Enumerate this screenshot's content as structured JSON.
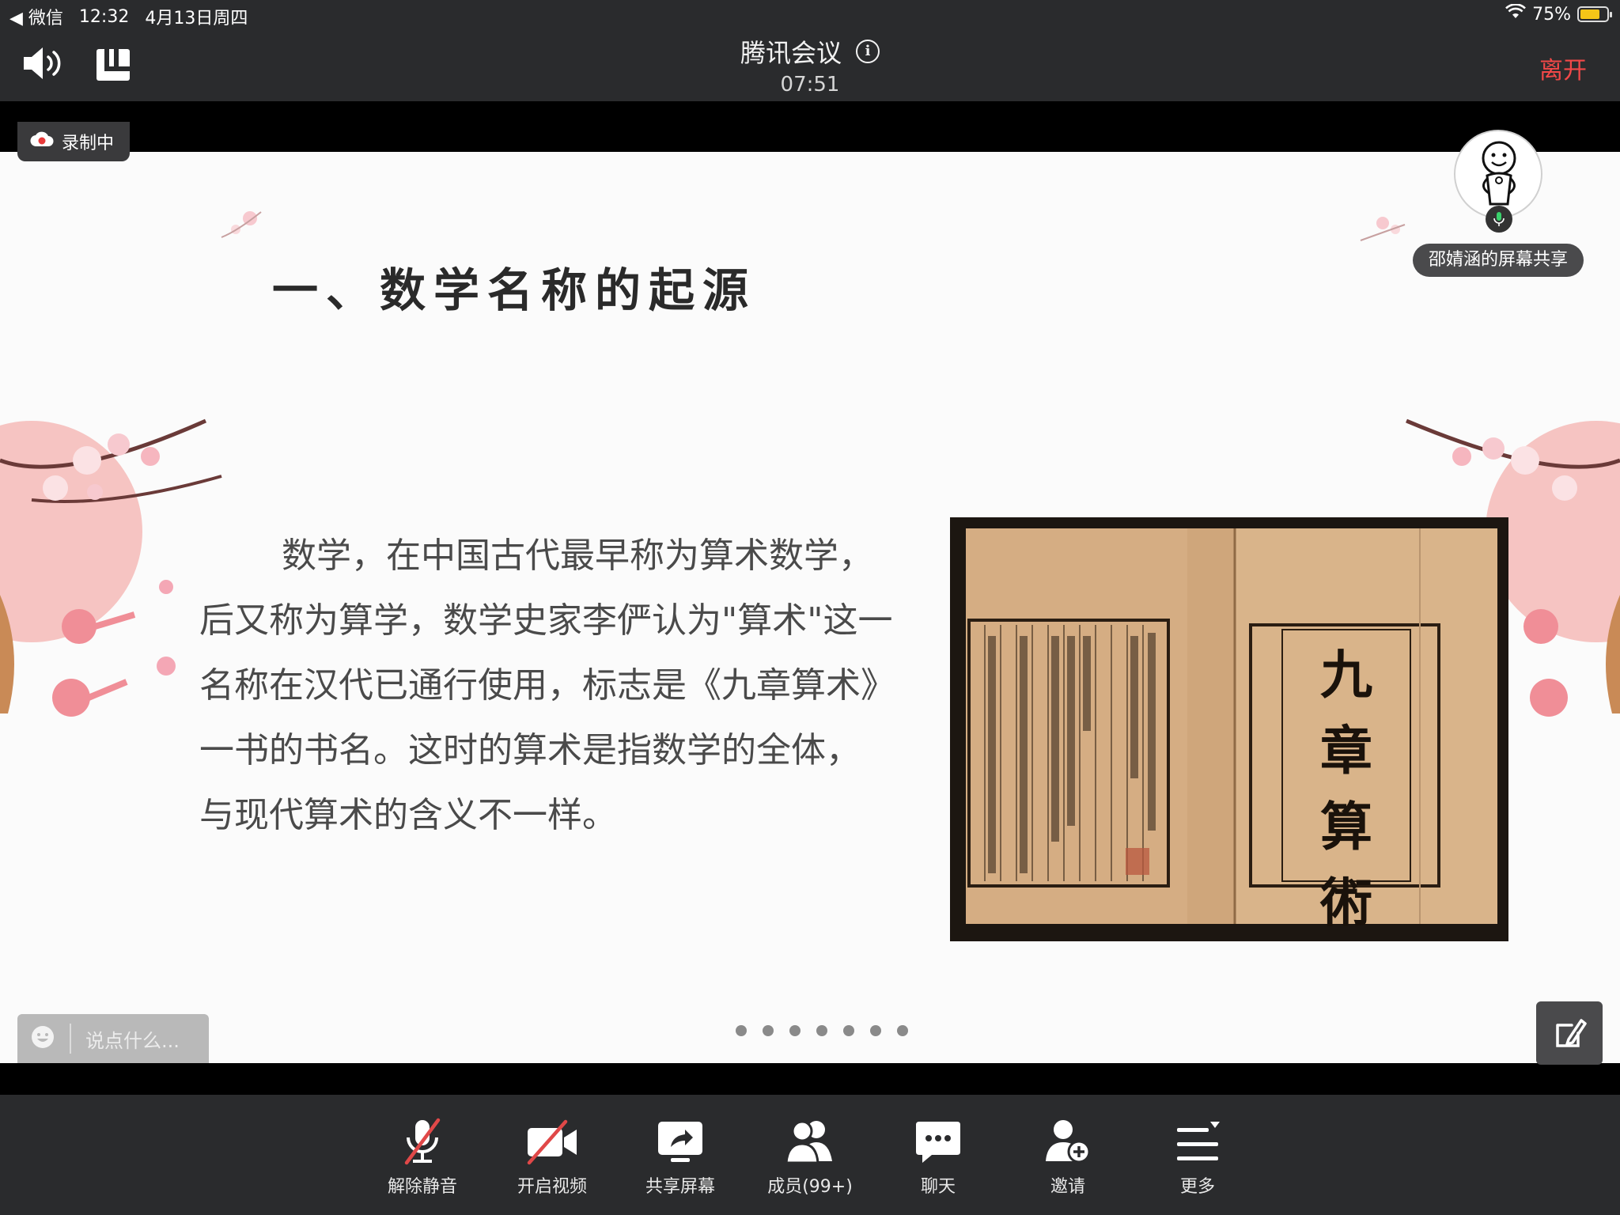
{
  "status_bar": {
    "back_app": "◀ 微信",
    "time": "12:32",
    "date": "4月13日周四",
    "battery": "75%",
    "battery_level": 0.75
  },
  "header": {
    "title": "腾讯会议",
    "timer": "07:51",
    "leave_label": "离开"
  },
  "recording": {
    "label": "录制中"
  },
  "presenter": {
    "label": "邵婧涵的屏幕共享"
  },
  "slide": {
    "title": "一、数学名称的起源",
    "paragraph_lines": [
      "数学，在中国古代最早称为算术数学，",
      "后又称为算学，数学史家李俨认为\"算术\"这一",
      "名称在汉代已通行使用，标志是《九章算术》",
      "一书的书名。这时的算术是指数学的全体，",
      "与现代算术的含义不一样。"
    ],
    "book_title_chars": [
      "九",
      "章",
      "算",
      "術"
    ],
    "page_dot_count": 7
  },
  "comment": {
    "placeholder": "说点什么..."
  },
  "toolbar": {
    "unmute": "解除静音",
    "start_video": "开启视频",
    "share_screen": "共享屏幕",
    "members": "成员(99+)",
    "chat": "聊天",
    "invite": "邀请",
    "more": "更多"
  },
  "colors": {
    "bar_bg": "#2a2b2d",
    "leave_red": "#f24848",
    "slash_red": "#e04848",
    "battery_yellow": "#f5c518",
    "slide_bg": "#fbfbfb",
    "blossom_pink": "#f3a3a8"
  }
}
